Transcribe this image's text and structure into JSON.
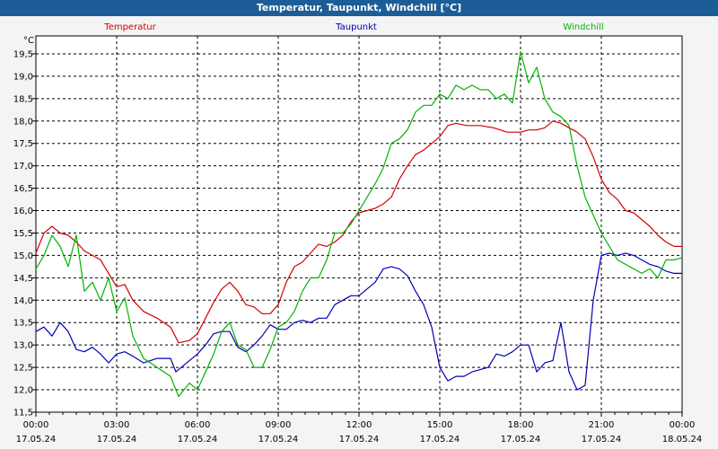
{
  "header": {
    "title": "Temperatur, Taupunkt, Windchill [°C]"
  },
  "colors": {
    "titlebar": "#1d5d97",
    "plot_bg": "#ffffff",
    "grid": "#000000"
  },
  "chart_data": {
    "type": "line",
    "title": "Temperatur, Taupunkt, Windchill [°C]",
    "ylabel": "°C",
    "xlabel": "",
    "ylim": [
      11.5,
      19.9
    ],
    "xlim": [
      0,
      24
    ],
    "grid": true,
    "legend_placement": "top",
    "y_ticks": [
      "11,5",
      "12,0",
      "12,5",
      "13,0",
      "13,5",
      "14,0",
      "14,5",
      "15,0",
      "15,5",
      "16,0",
      "16,5",
      "17,0",
      "17,5",
      "18,0",
      "18,5",
      "19,0",
      "19,5"
    ],
    "x_ticks": [
      {
        "time": "00:00",
        "date": "17.05.24"
      },
      {
        "time": "03:00",
        "date": "17.05.24"
      },
      {
        "time": "06:00",
        "date": "17.05.24"
      },
      {
        "time": "09:00",
        "date": "17.05.24"
      },
      {
        "time": "12:00",
        "date": "17.05.24"
      },
      {
        "time": "15:00",
        "date": "17.05.24"
      },
      {
        "time": "18:00",
        "date": "17.05.24"
      },
      {
        "time": "21:00",
        "date": "17.05.24"
      },
      {
        "time": "00:00",
        "date": "18.05.24"
      }
    ],
    "series": [
      {
        "name": "Temperatur",
        "color": "#d40000",
        "x": [
          0,
          0.3,
          0.6,
          0.9,
          1.2,
          1.5,
          1.8,
          2.1,
          2.4,
          2.7,
          3.0,
          3.3,
          3.6,
          4.0,
          4.5,
          5.0,
          5.3,
          5.7,
          6.0,
          6.3,
          6.6,
          6.9,
          7.2,
          7.5,
          7.8,
          8.1,
          8.4,
          8.7,
          9.0,
          9.3,
          9.6,
          9.9,
          10.2,
          10.5,
          10.8,
          11.1,
          11.4,
          11.7,
          12.0,
          12.3,
          12.6,
          12.9,
          13.2,
          13.5,
          13.8,
          14.1,
          14.4,
          14.7,
          15.0,
          15.3,
          15.6,
          16.0,
          16.5,
          17.0,
          17.5,
          18.0,
          18.3,
          18.6,
          18.9,
          19.2,
          19.5,
          19.8,
          20.1,
          20.4,
          20.7,
          21.0,
          21.3,
          21.6,
          21.9,
          22.2,
          22.5,
          22.8,
          23.1,
          23.4,
          23.7,
          24.0
        ],
        "values": [
          15.05,
          15.5,
          15.65,
          15.5,
          15.45,
          15.3,
          15.1,
          15.0,
          14.9,
          14.6,
          14.3,
          14.35,
          14.0,
          13.75,
          13.6,
          13.4,
          13.05,
          13.1,
          13.25,
          13.6,
          13.95,
          14.25,
          14.4,
          14.2,
          13.9,
          13.85,
          13.7,
          13.7,
          13.9,
          14.4,
          14.75,
          14.85,
          15.05,
          15.25,
          15.2,
          15.3,
          15.45,
          15.75,
          15.95,
          16.0,
          16.05,
          16.15,
          16.3,
          16.7,
          17.0,
          17.25,
          17.35,
          17.5,
          17.65,
          17.9,
          17.95,
          17.9,
          17.9,
          17.85,
          17.75,
          17.75,
          17.8,
          17.8,
          17.85,
          18.0,
          17.95,
          17.85,
          17.75,
          17.6,
          17.2,
          16.7,
          16.4,
          16.25,
          16.0,
          15.95,
          15.8,
          15.65,
          15.45,
          15.3,
          15.2,
          15.2
        ]
      },
      {
        "name": "Taupunkt",
        "color": "#0000b4",
        "x": [
          0,
          0.3,
          0.6,
          0.9,
          1.2,
          1.5,
          1.8,
          2.1,
          2.4,
          2.7,
          3.0,
          3.3,
          3.6,
          4.0,
          4.5,
          5.0,
          5.2,
          5.5,
          6.0,
          6.3,
          6.6,
          6.9,
          7.2,
          7.5,
          7.8,
          8.1,
          8.4,
          8.7,
          9.0,
          9.3,
          9.6,
          9.9,
          10.2,
          10.5,
          10.8,
          11.1,
          11.4,
          11.7,
          12.0,
          12.3,
          12.6,
          12.9,
          13.2,
          13.5,
          13.8,
          14.1,
          14.4,
          14.7,
          15.0,
          15.3,
          15.6,
          15.9,
          16.2,
          16.5,
          16.8,
          17.1,
          17.4,
          17.7,
          18.0,
          18.3,
          18.6,
          18.9,
          19.2,
          19.5,
          19.8,
          20.1,
          20.4,
          20.7,
          21.0,
          21.3,
          21.6,
          21.9,
          22.2,
          22.5,
          22.8,
          23.1,
          23.4,
          23.7,
          24.0
        ],
        "values": [
          13.3,
          13.4,
          13.2,
          13.5,
          13.3,
          12.9,
          12.85,
          12.95,
          12.8,
          12.6,
          12.8,
          12.85,
          12.75,
          12.6,
          12.7,
          12.7,
          12.4,
          12.55,
          12.8,
          13.0,
          13.25,
          13.3,
          13.3,
          12.95,
          12.85,
          13.0,
          13.2,
          13.45,
          13.35,
          13.35,
          13.5,
          13.55,
          13.5,
          13.6,
          13.6,
          13.9,
          14.0,
          14.1,
          14.1,
          14.25,
          14.4,
          14.7,
          14.75,
          14.7,
          14.55,
          14.2,
          13.9,
          13.4,
          12.5,
          12.2,
          12.3,
          12.3,
          12.4,
          12.45,
          12.5,
          12.8,
          12.75,
          12.85,
          13.0,
          13.0,
          12.4,
          12.6,
          12.65,
          13.5,
          12.4,
          12.0,
          12.1,
          14.0,
          15.0,
          15.05,
          15.0,
          15.05,
          15.0,
          14.9,
          14.8,
          14.75,
          14.65,
          14.6,
          14.6
        ]
      },
      {
        "name": "Windchill",
        "color": "#00b400",
        "x": [
          0,
          0.3,
          0.6,
          0.9,
          1.2,
          1.5,
          1.8,
          2.1,
          2.4,
          2.7,
          3.0,
          3.3,
          3.6,
          4.0,
          4.5,
          5.0,
          5.3,
          5.7,
          6.0,
          6.3,
          6.6,
          6.9,
          7.2,
          7.5,
          7.8,
          8.1,
          8.4,
          8.7,
          9.0,
          9.3,
          9.6,
          9.9,
          10.2,
          10.5,
          10.8,
          11.1,
          11.4,
          11.7,
          12.0,
          12.3,
          12.6,
          12.9,
          13.2,
          13.5,
          13.8,
          14.1,
          14.4,
          14.7,
          15.0,
          15.3,
          15.6,
          15.9,
          16.2,
          16.5,
          16.8,
          17.1,
          17.4,
          17.7,
          18.0,
          18.3,
          18.6,
          18.9,
          19.2,
          19.5,
          19.8,
          20.1,
          20.4,
          20.7,
          21.0,
          21.3,
          21.6,
          21.9,
          22.2,
          22.5,
          22.8,
          23.1,
          23.4,
          23.7,
          24.0
        ],
        "values": [
          14.7,
          15.0,
          15.45,
          15.2,
          14.75,
          15.45,
          14.2,
          14.4,
          14.0,
          14.5,
          13.75,
          14.05,
          13.2,
          12.7,
          12.5,
          12.3,
          11.85,
          12.15,
          12.0,
          12.4,
          12.8,
          13.3,
          13.5,
          13.0,
          12.9,
          12.5,
          12.5,
          12.9,
          13.4,
          13.5,
          13.75,
          14.2,
          14.5,
          14.5,
          14.9,
          15.5,
          15.5,
          15.7,
          16.0,
          16.3,
          16.6,
          16.95,
          17.5,
          17.6,
          17.8,
          18.2,
          18.35,
          18.35,
          18.6,
          18.5,
          18.8,
          18.7,
          18.8,
          18.7,
          18.7,
          18.5,
          18.6,
          18.4,
          19.55,
          18.85,
          19.2,
          18.5,
          18.2,
          18.1,
          17.9,
          17.0,
          16.3,
          15.9,
          15.5,
          15.2,
          14.9,
          14.8,
          14.7,
          14.6,
          14.7,
          14.5,
          14.9,
          14.9,
          14.95
        ]
      }
    ]
  }
}
